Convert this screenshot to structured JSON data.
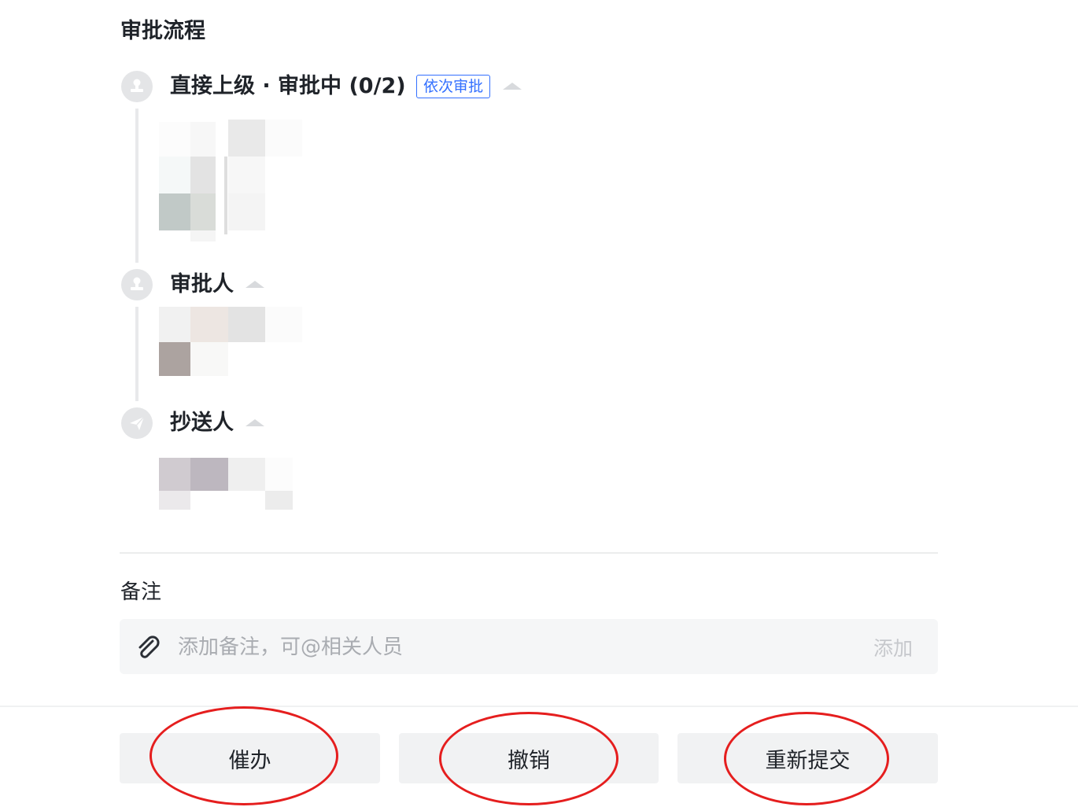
{
  "process": {
    "title": "审批流程",
    "steps": [
      {
        "label": "直接上级 · 审批中 (0/2)",
        "tag": "依次审批"
      },
      {
        "label": "审批人"
      },
      {
        "label": "抄送人"
      }
    ]
  },
  "notes": {
    "title": "备注",
    "placeholder": "添加备注，可@相关人员",
    "add_label": "添加"
  },
  "actions": {
    "urge": "催办",
    "revoke": "撤销",
    "resubmit": "重新提交"
  },
  "colors": {
    "accent": "#3370ff",
    "annotation": "#e51e1e"
  }
}
